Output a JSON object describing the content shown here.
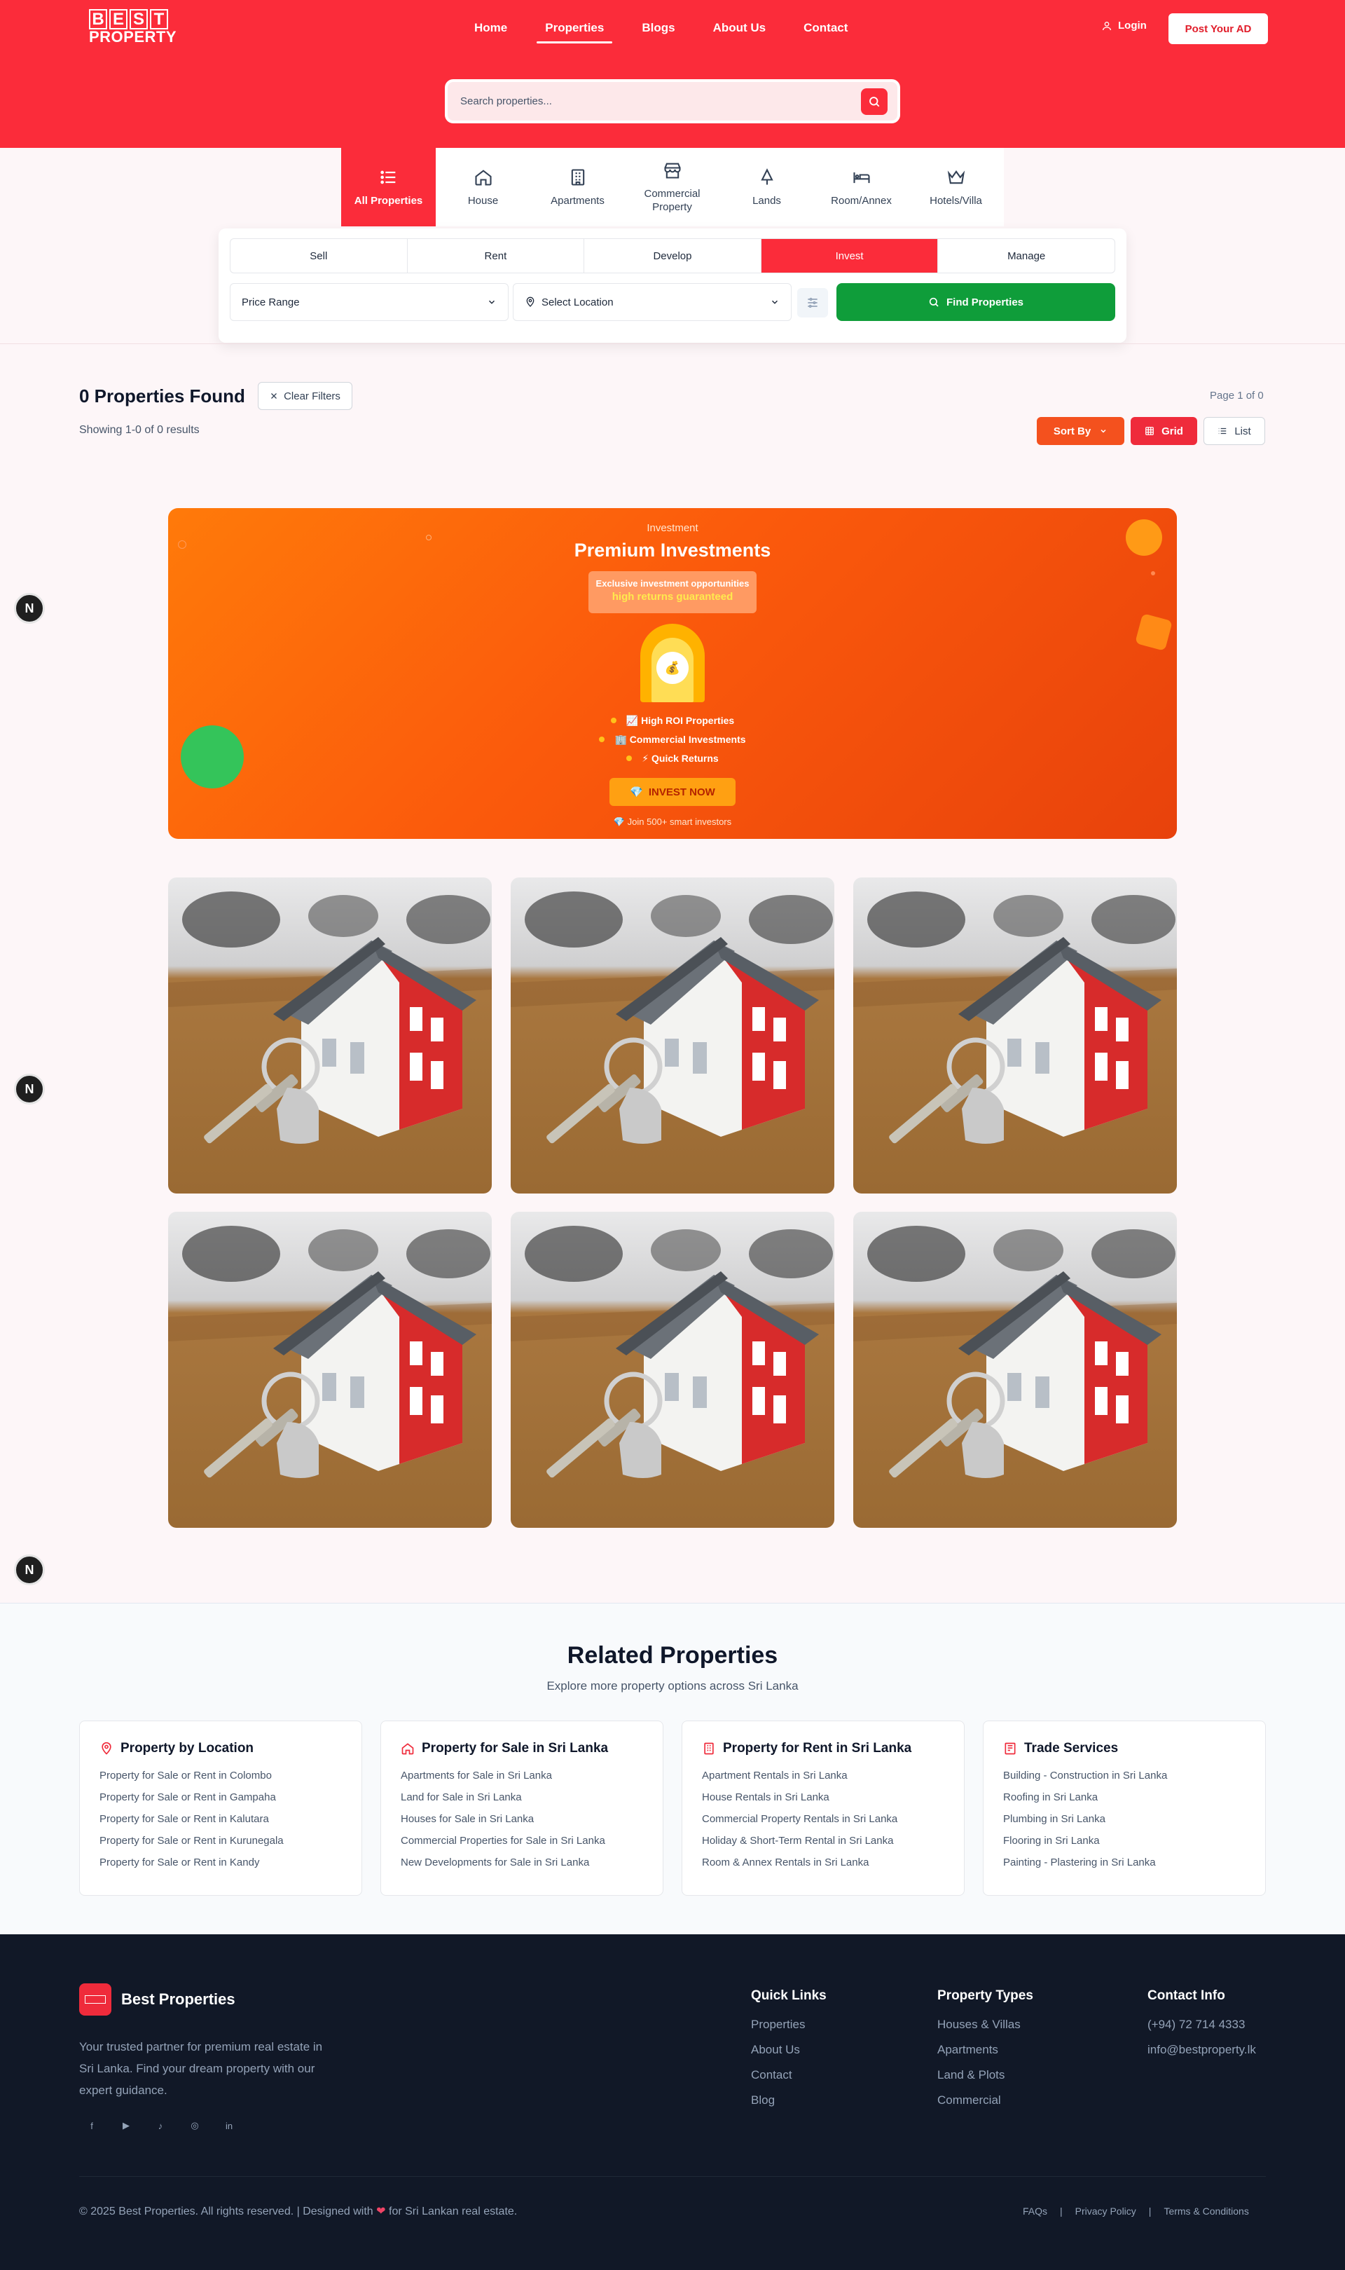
{
  "header": {
    "logo": {
      "letters": [
        "B",
        "E",
        "S",
        "T"
      ],
      "word": "PROPERTY"
    },
    "nav": [
      "Home",
      "Properties",
      "Blogs",
      "About Us",
      "Contact"
    ],
    "nav_active": "Properties",
    "login": "Login",
    "post_ad": "Post Your AD",
    "search": {
      "placeholder": "Search properties..."
    }
  },
  "categories": [
    {
      "label": "All Properties",
      "icon": "list-icon",
      "active": true
    },
    {
      "label": "House",
      "icon": "house-icon",
      "active": false
    },
    {
      "label": "Apartments",
      "icon": "building-icon",
      "active": false
    },
    {
      "label": "Commercial Property",
      "icon": "store-icon",
      "active": false
    },
    {
      "label": "Lands",
      "icon": "tree-icon",
      "active": false
    },
    {
      "label": "Room/Annex",
      "icon": "bed-icon",
      "active": false
    },
    {
      "label": "Hotels/Villa",
      "icon": "crown-icon",
      "active": false
    }
  ],
  "filters": {
    "intents": [
      "Sell",
      "Rent",
      "Develop",
      "Invest",
      "Manage"
    ],
    "active_intent": "Invest",
    "price_range": "Price Range",
    "location": "Select Location",
    "find_button": "Find Properties"
  },
  "results": {
    "title": "0 Properties Found",
    "clear_filters": "Clear Filters",
    "showing": "Showing 1-0 of 0 results",
    "page_info": "Page 1 of 0",
    "sort_by": "Sort By",
    "grid": "Grid",
    "list": "List"
  },
  "banner": {
    "eyebrow": "Investment",
    "title": "Premium Investments",
    "pill_line1": "Exclusive investment opportunities",
    "pill_line2": "high returns guaranteed",
    "features": [
      "📈 High ROI Properties",
      "🏢 Commercial Investments",
      "⚡ Quick Returns"
    ],
    "cta": "INVEST NOW",
    "join": "Join 500+ smart investors",
    "colors": {
      "start": "#ff7a0a",
      "end": "#e8420c"
    }
  },
  "property_images": 6,
  "related": {
    "title": "Related Properties",
    "subtitle": "Explore more property options across Sri Lanka",
    "columns": [
      {
        "heading": "Property by Location",
        "icon": "map-pin-icon",
        "items": [
          "Property for Sale or Rent in Colombo",
          "Property for Sale or Rent in Gampaha",
          "Property for Sale or Rent in Kalutara",
          "Property for Sale or Rent in Kurunegala",
          "Property for Sale or Rent in Kandy"
        ]
      },
      {
        "heading": "Property for Sale in Sri Lanka",
        "icon": "house-icon",
        "items": [
          "Apartments for Sale in Sri Lanka",
          "Land for Sale in Sri Lanka",
          "Houses for Sale in Sri Lanka",
          "Commercial Properties for Sale in Sri Lanka",
          "New Developments for Sale in Sri Lanka"
        ]
      },
      {
        "heading": "Property for Rent in Sri Lanka",
        "icon": "building-icon",
        "items": [
          "Apartment Rentals in Sri Lanka",
          "House Rentals in Sri Lanka",
          "Commercial Property Rentals in Sri Lanka",
          "Holiday & Short-Term Rental in Sri Lanka",
          "Room & Annex Rentals in Sri Lanka"
        ]
      },
      {
        "heading": "Trade Services",
        "icon": "hammer-icon",
        "items": [
          "Building - Construction in Sri Lanka",
          "Roofing in Sri Lanka",
          "Plumbing in Sri Lanka",
          "Flooring in Sri Lanka",
          "Painting - Plastering in Sri Lanka"
        ]
      }
    ]
  },
  "footer": {
    "brand": "Best Properties",
    "description": "Your trusted partner for premium real estate in Sri Lanka. Find your dream property with our expert guidance.",
    "socials": [
      "facebook-icon",
      "youtube-icon",
      "tiktok-icon",
      "instagram-icon",
      "linkedin-icon"
    ],
    "quick_links": {
      "heading": "Quick Links",
      "items": [
        "Properties",
        "About Us",
        "Contact",
        "Blog"
      ]
    },
    "property_types": {
      "heading": "Property Types",
      "items": [
        "Houses & Villas",
        "Apartments",
        "Land & Plots",
        "Commercial"
      ]
    },
    "contact": {
      "heading": "Contact Info",
      "phone": "(+94) 72 714 4333",
      "email": "info@bestproperty.lk"
    },
    "copyright_pre": "© 2025 Best Properties. All rights reserved. | Designed with",
    "copyright_post": "for Sri Lankan real estate.",
    "legal": [
      "FAQs",
      "|",
      "Privacy Policy",
      "|",
      "Terms & Conditions"
    ]
  },
  "floating_badge": "N",
  "colors": {
    "brand_red": "#fb2c3a",
    "green": "#0f9d3a",
    "orange": "#f4511e",
    "footer_bg": "#111827"
  }
}
